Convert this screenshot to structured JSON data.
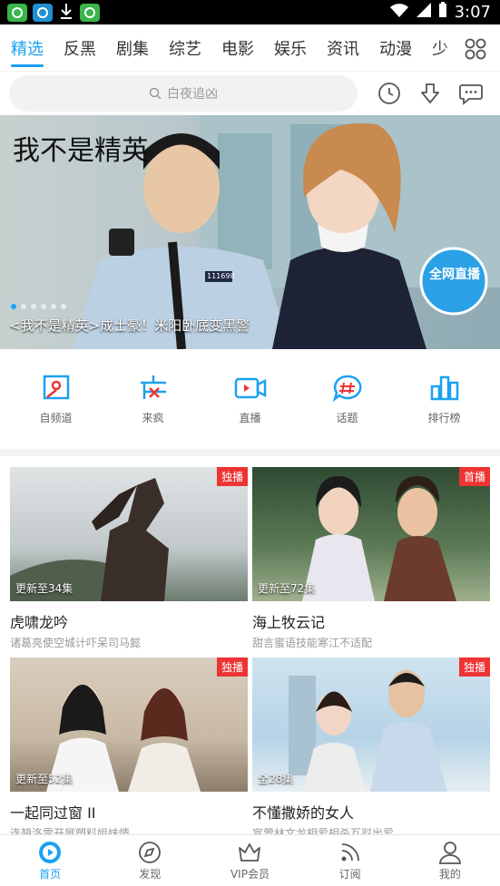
{
  "status": {
    "time": "3:07",
    "icons": [
      "app-icon-1",
      "app-icon-2",
      "download-icon",
      "app-icon-3",
      "wifi-icon",
      "signal-icon",
      "battery-icon"
    ]
  },
  "tabs": [
    "精选",
    "反黑",
    "剧集",
    "综艺",
    "电影",
    "娱乐",
    "资讯",
    "动漫",
    "少"
  ],
  "search": {
    "placeholder": "白夜追凶"
  },
  "banner": {
    "logo": "我不是精英",
    "caption": "<我不是精英>成士豪！米阳卧底变黑警",
    "live_badge": "全网直播",
    "police_number": "111698"
  },
  "quick": [
    {
      "label": "自频道",
      "icon": "self-channel-icon"
    },
    {
      "label": "来疯",
      "icon": "laifeng-icon"
    },
    {
      "label": "直播",
      "icon": "live-icon"
    },
    {
      "label": "话题",
      "icon": "topic-icon"
    },
    {
      "label": "排行榜",
      "icon": "ranking-icon"
    }
  ],
  "cards": [
    {
      "title": "虎啸龙吟",
      "sub": "诸葛亮使空城计吓呆司马懿",
      "cap": "更新至34集",
      "badge": "独播"
    },
    {
      "title": "海上牧云记",
      "sub": "甜言蜜语技能寒江不适配",
      "cap": "更新至72集",
      "badge": "首播"
    },
    {
      "title": "一起同过窗 II",
      "sub": "连翘洛雪开展塑料姐妹情",
      "cap": "更新至52集",
      "badge": "独播"
    },
    {
      "title": "不懂撒娇的女人",
      "sub": "宣萱林文龙相爱相杀互怼出爱",
      "cap": "全28集",
      "badge": "独播"
    }
  ],
  "bottom": [
    {
      "label": "首页"
    },
    {
      "label": "发现"
    },
    {
      "label": "VIP会员"
    },
    {
      "label": "订阅"
    },
    {
      "label": "我的"
    }
  ],
  "colors": {
    "accent": "#1aa2f0",
    "badge": "#e33333"
  }
}
